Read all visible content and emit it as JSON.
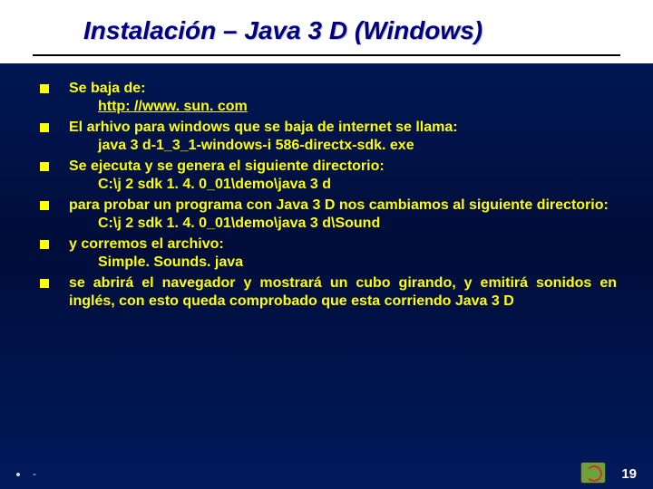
{
  "title": "Instalación – Java 3 D (Windows)",
  "items": [
    {
      "text": "Se baja de:",
      "sub": "http: //www. sun. com",
      "subUnderline": true
    },
    {
      "text": "El arhivo para windows que se baja de internet se llama:",
      "sub": "java 3 d-1_3_1-windows-i 586-directx-sdk. exe"
    },
    {
      "text": "Se ejecuta y se genera el siguiente directorio:",
      "sub": "C:\\j 2 sdk 1. 4. 0_01\\demo\\java 3 d"
    },
    {
      "text": "para probar un programa con Java 3 D nos cambiamos al siguiente directorio:",
      "sub": "C:\\j 2 sdk 1. 4. 0_01\\demo\\java 3 d\\Sound"
    },
    {
      "text": "y corremos el archivo:",
      "sub": "Simple. Sounds. java"
    },
    {
      "text": "se abrirá el navegador y mostrará un cubo girando, y emitirá sonidos en inglés, con esto queda comprobado que esta corriendo Java 3 D",
      "sub": null
    }
  ],
  "footer": {
    "page": "19",
    "dash": "-"
  }
}
